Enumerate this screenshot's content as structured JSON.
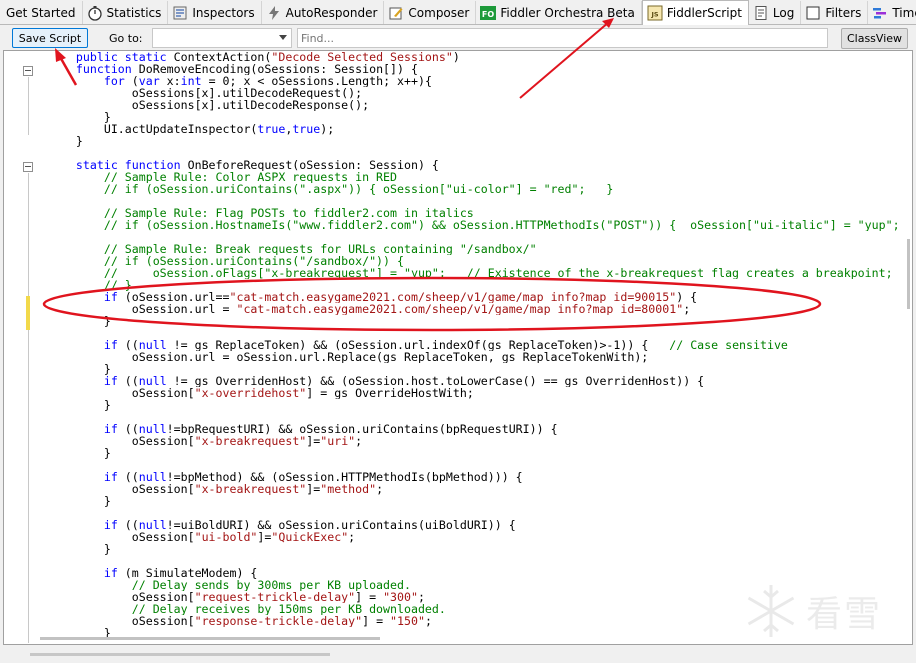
{
  "tabs": [
    {
      "label": "Get Started",
      "icon": "none"
    },
    {
      "label": "Statistics",
      "icon": "stopwatch-icon"
    },
    {
      "label": "Inspectors",
      "icon": "inspector-icon"
    },
    {
      "label": "AutoResponder",
      "icon": "lightning-icon"
    },
    {
      "label": "Composer",
      "icon": "composer-icon"
    },
    {
      "label": "Fiddler Orchestra Beta",
      "icon": "fo-icon",
      "icon_text": "FO"
    },
    {
      "label": "FiddlerScript",
      "icon": "js-icon",
      "icon_text": "JS",
      "active": true
    },
    {
      "label": "Log",
      "icon": "log-icon"
    },
    {
      "label": "Filters",
      "icon": "checkbox-icon"
    },
    {
      "label": "Timeline",
      "icon": "timeline-icon"
    }
  ],
  "toolbar": {
    "save_label": "Save Script",
    "goto_label": "Go to:",
    "goto_value": "",
    "find_placeholder": "Find...",
    "classview_label": "ClassView"
  },
  "code_lines": [
    [
      [
        "k",
        "    public static "
      ],
      [
        "f",
        "ContextAction("
      ],
      [
        "s",
        "\"Decode Selected Sessions\""
      ],
      [
        "f",
        ")"
      ]
    ],
    [
      [
        "k",
        "    function "
      ],
      [
        "f",
        "DoRemoveEncoding(oSessions: Session[]) {"
      ]
    ],
    [
      [
        "k",
        "        for "
      ],
      [
        "f",
        "("
      ],
      [
        "k",
        "var "
      ],
      [
        "f",
        "x:"
      ],
      [
        "k",
        "int "
      ],
      [
        "f",
        "= 0; x < oSessions.Length; x++){"
      ]
    ],
    [
      [
        "f",
        "            oSessions[x].utilDecodeRequest();"
      ]
    ],
    [
      [
        "f",
        "            oSessions[x].utilDecodeResponse();"
      ]
    ],
    [
      [
        "f",
        "        }"
      ]
    ],
    [
      [
        "f",
        "        UI.actUpdateInspector("
      ],
      [
        "k",
        "true"
      ],
      [
        "f",
        ","
      ],
      [
        "k",
        "true"
      ],
      [
        "f",
        ");"
      ]
    ],
    [
      [
        "f",
        "    }"
      ]
    ],
    [
      [
        "f",
        ""
      ]
    ],
    [
      [
        "k",
        "    static function "
      ],
      [
        "f",
        "OnBeforeRequest(oSession: Session) {"
      ]
    ],
    [
      [
        "c",
        "        // Sample Rule: Color ASPX requests in RED"
      ]
    ],
    [
      [
        "c",
        "        // if (oSession.uriContains(\".aspx\")) { oSession[\"ui-color\"] = \"red\";   }"
      ]
    ],
    [
      [
        "f",
        ""
      ]
    ],
    [
      [
        "c",
        "        // Sample Rule: Flag POSTs to fiddler2.com in italics"
      ]
    ],
    [
      [
        "c",
        "        // if (oSession.HostnameIs(\"www.fiddler2.com\") && oSession.HTTPMethodIs(\"POST\")) {  oSession[\"ui-italic\"] = \"yup\"; }"
      ]
    ],
    [
      [
        "f",
        ""
      ]
    ],
    [
      [
        "c",
        "        // Sample Rule: Break requests for URLs containing \"/sandbox/\""
      ]
    ],
    [
      [
        "c",
        "        // if (oSession.uriContains(\"/sandbox/\")) {"
      ]
    ],
    [
      [
        "c",
        "        //     oSession.oFlags[\"x-breakrequest\"] = \"yup\";   // Existence of the x-breakrequest flag creates a breakpoint; the \"yup\" value is unimportant."
      ]
    ],
    [
      [
        "c",
        "        // }"
      ]
    ],
    [
      [
        "k",
        "        if "
      ],
      [
        "f",
        "(oSession.url=="
      ],
      [
        "s",
        "\"cat-match.easygame2021.com/sheep/v1/game/map_info?map_id=90015\""
      ],
      [
        "f",
        ") {"
      ]
    ],
    [
      [
        "f",
        "            oSession.url = "
      ],
      [
        "s",
        "\"cat-match.easygame2021.com/sheep/v1/game/map_info?map_id=80001\""
      ],
      [
        "f",
        ";"
      ]
    ],
    [
      [
        "f",
        "        }"
      ]
    ],
    [
      [
        "f",
        ""
      ]
    ],
    [
      [
        "k",
        "        if "
      ],
      [
        "f",
        "(("
      ],
      [
        "k",
        "null "
      ],
      [
        "f",
        "!= gs_ReplaceToken) && (oSession.url.indexOf(gs_ReplaceToken)>-1)) {   "
      ],
      [
        "c",
        "// Case sensitive"
      ]
    ],
    [
      [
        "f",
        "            oSession.url = oSession.url.Replace(gs_ReplaceToken, gs_ReplaceTokenWith);"
      ]
    ],
    [
      [
        "f",
        "        }"
      ]
    ],
    [
      [
        "k",
        "        if "
      ],
      [
        "f",
        "(("
      ],
      [
        "k",
        "null "
      ],
      [
        "f",
        "!= gs_OverridenHost) && (oSession.host.toLowerCase() == gs_OverridenHost)) {"
      ]
    ],
    [
      [
        "f",
        "            oSession["
      ],
      [
        "s",
        "\"x-overridehost\""
      ],
      [
        "f",
        "] = gs_OverrideHostWith;"
      ]
    ],
    [
      [
        "f",
        "        }"
      ]
    ],
    [
      [
        "f",
        ""
      ]
    ],
    [
      [
        "k",
        "        if "
      ],
      [
        "f",
        "(("
      ],
      [
        "k",
        "null"
      ],
      [
        "f",
        "!=bpRequestURI) && oSession.uriContains(bpRequestURI)) {"
      ]
    ],
    [
      [
        "f",
        "            oSession["
      ],
      [
        "s",
        "\"x-breakrequest\""
      ],
      [
        "f",
        "]="
      ],
      [
        "s",
        "\"uri\""
      ],
      [
        "f",
        ";"
      ]
    ],
    [
      [
        "f",
        "        }"
      ]
    ],
    [
      [
        "f",
        ""
      ]
    ],
    [
      [
        "k",
        "        if "
      ],
      [
        "f",
        "(("
      ],
      [
        "k",
        "null"
      ],
      [
        "f",
        "!=bpMethod) && (oSession.HTTPMethodIs(bpMethod))) {"
      ]
    ],
    [
      [
        "f",
        "            oSession["
      ],
      [
        "s",
        "\"x-breakrequest\""
      ],
      [
        "f",
        "]="
      ],
      [
        "s",
        "\"method\""
      ],
      [
        "f",
        ";"
      ]
    ],
    [
      [
        "f",
        "        }"
      ]
    ],
    [
      [
        "f",
        ""
      ]
    ],
    [
      [
        "k",
        "        if "
      ],
      [
        "f",
        "(("
      ],
      [
        "k",
        "null"
      ],
      [
        "f",
        "!=uiBoldURI) && oSession.uriContains(uiBoldURI)) {"
      ]
    ],
    [
      [
        "f",
        "            oSession["
      ],
      [
        "s",
        "\"ui-bold\""
      ],
      [
        "f",
        "]="
      ],
      [
        "s",
        "\"QuickExec\""
      ],
      [
        "f",
        ";"
      ]
    ],
    [
      [
        "f",
        "        }"
      ]
    ],
    [
      [
        "f",
        ""
      ]
    ],
    [
      [
        "k",
        "        if "
      ],
      [
        "f",
        "(m_SimulateModem) {"
      ]
    ],
    [
      [
        "c",
        "            // Delay sends by 300ms per KB uploaded."
      ]
    ],
    [
      [
        "f",
        "            oSession["
      ],
      [
        "s",
        "\"request-trickle-delay\""
      ],
      [
        "f",
        "] = "
      ],
      [
        "s",
        "\"300\""
      ],
      [
        "f",
        ";"
      ]
    ],
    [
      [
        "c",
        "            // Delay receives by 150ms per KB downloaded."
      ]
    ],
    [
      [
        "f",
        "            oSession["
      ],
      [
        "s",
        "\"response-trickle-delay\""
      ],
      [
        "f",
        "] = "
      ],
      [
        "s",
        "\"150\""
      ],
      [
        "f",
        ";"
      ]
    ],
    [
      [
        "f",
        "        }"
      ]
    ]
  ],
  "colors": {
    "keyword": "#0000ff",
    "string": "#a31515",
    "comment": "#008000",
    "annotation": "#e0141e",
    "modified_marker": "#f2d94a"
  },
  "watermark": {
    "text": "看雪",
    "icon": "snowflake-icon"
  }
}
